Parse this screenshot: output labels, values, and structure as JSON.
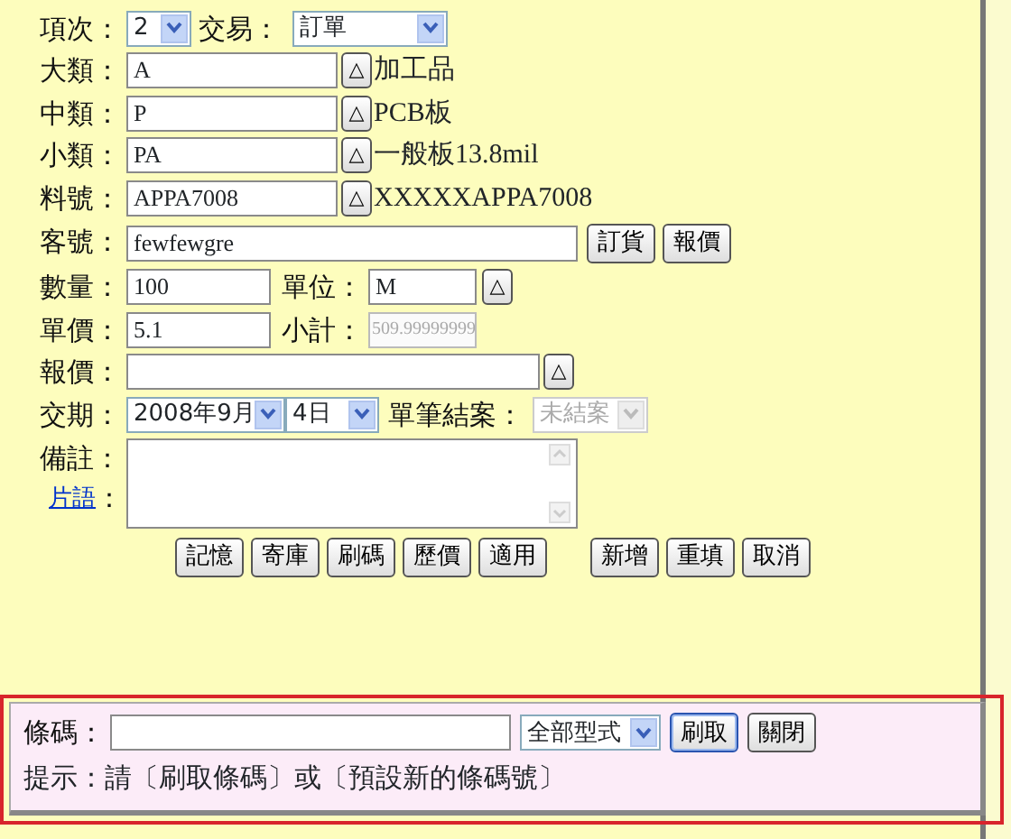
{
  "header": {
    "item_label": "項次：",
    "item_value": "2",
    "trade_label": "交易：",
    "trade_value": "訂單"
  },
  "categories": [
    {
      "label": "大類：",
      "value": "A",
      "lookup": "△",
      "description": "加工品"
    },
    {
      "label": "中類：",
      "value": "P",
      "lookup": "△",
      "description": "PCB板"
    },
    {
      "label": "小類：",
      "value": "PA",
      "lookup": "△",
      "description": "一般板13.8mil"
    },
    {
      "label": "料號：",
      "value": "APPA7008",
      "lookup": "△",
      "description": "XXXXXAPPA7008"
    }
  ],
  "customer": {
    "label": "客號：",
    "value": "fewfewgre",
    "buttons": [
      "訂貨",
      "報價"
    ]
  },
  "quantity": {
    "label": "數量：",
    "value": "100"
  },
  "unit": {
    "label": "單位：",
    "value": "M",
    "lookup": "△"
  },
  "price": {
    "label": "單價：",
    "value": "5.1"
  },
  "subtotal": {
    "label": "小計：",
    "value": "509.99999999",
    "disabled": true
  },
  "quote": {
    "label": "報價：",
    "lookup": "△"
  },
  "delivery": {
    "label": "交期：",
    "month": "2008年9月",
    "day": "4日",
    "close_label": "單筆結案：",
    "close_value": "未結案",
    "close_disabled": true
  },
  "remarks": {
    "label": "備註：",
    "phrase_link": "片語",
    "phrase_colon": "："
  },
  "actions": [
    {
      "label": "記憶",
      "gap_before": false
    },
    {
      "label": "寄庫",
      "gap_before": false
    },
    {
      "label": "刷碼",
      "gap_before": false
    },
    {
      "label": "歷價",
      "gap_before": false
    },
    {
      "label": "適用",
      "gap_before": false
    },
    {
      "label": "新增",
      "gap_before": true
    },
    {
      "label": "重填",
      "gap_before": false
    },
    {
      "label": "取消",
      "gap_before": false
    }
  ],
  "barcode_popup": {
    "label": "條碼：",
    "type_value": "全部型式",
    "buttons": [
      {
        "label": "刷取",
        "focused": true
      },
      {
        "label": "關閉",
        "focused": false
      }
    ],
    "hint": "提示：請〔刷取條碼〕或〔預設新的條碼號〕"
  }
}
